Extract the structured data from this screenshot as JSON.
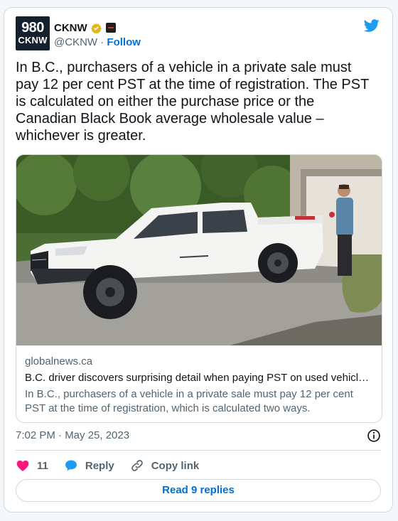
{
  "author": {
    "avatar_line1": "980",
    "avatar_line2": "CKNW",
    "name": "CKNW",
    "handle": "@CKNW",
    "separator": "·",
    "follow_label": "Follow",
    "verified_icon": "gold-verified-badge-icon",
    "affiliate_icon": "affiliate-badge-icon"
  },
  "platform_icon": "twitter-bird-icon",
  "tweet": {
    "text": "In B.C., purchasers of a vehicle in a private sale must pay 12 per cent PST at the time of registration. The PST is calculated on either the purchase price or the Canadian Black Book average wholesale value – whichever is greater."
  },
  "link_card": {
    "domain": "globalnews.ca",
    "title": "B.C. driver discovers surprising detail when paying PST on used vehicl…",
    "description": "In B.C., purchasers of a vehicle in a private sale must pay 12 per cent PST at the time of registration, which is calculated two ways."
  },
  "meta": {
    "timestamp": "7:02 PM · May 25, 2023",
    "info_icon": "info-icon"
  },
  "actions": {
    "like_count": "11",
    "reply_label": "Reply",
    "copy_link_label": "Copy link"
  },
  "read_replies_label": "Read 9 replies",
  "colors": {
    "accent": "#006fd6",
    "heart": "#f91880",
    "reply_bubble": "#1d9bf0",
    "bird": "#1d9bf0"
  }
}
